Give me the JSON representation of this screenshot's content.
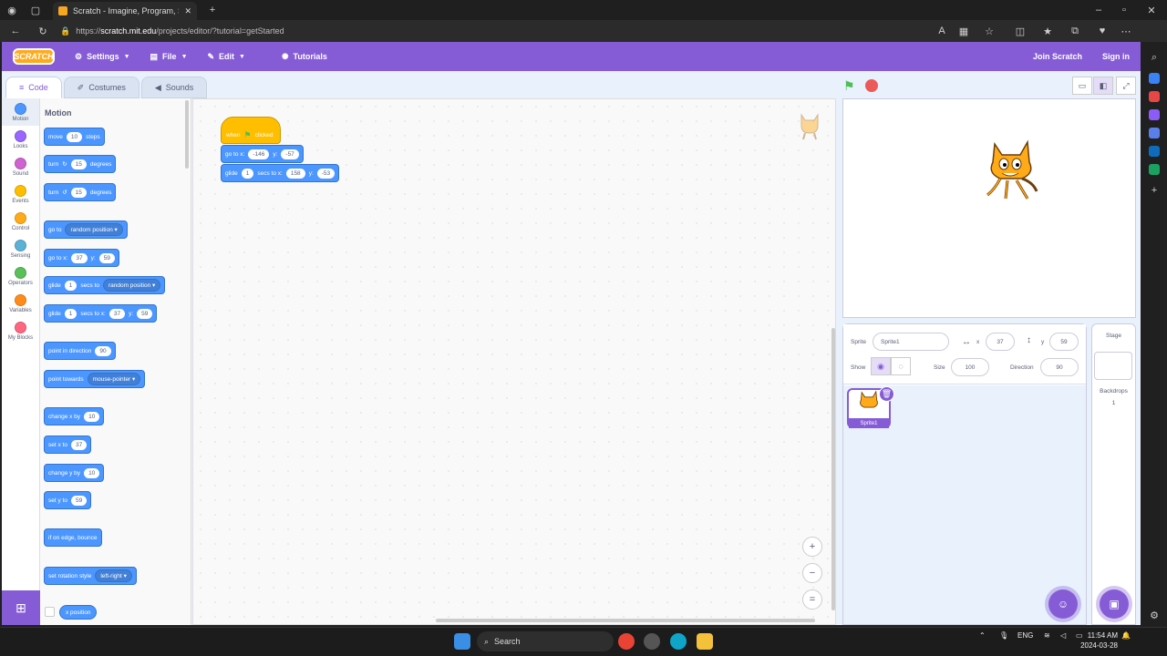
{
  "browser": {
    "tab_title": "Scratch - Imagine, Program, Sha",
    "url_host": "scratch.mit.edu",
    "url_prefix": "https://",
    "url_path": "/projects/editor/?tutorial=getStarted"
  },
  "menubar": {
    "logo": "SCRATCH",
    "settings": "Settings",
    "file": "File",
    "edit": "Edit",
    "tutorials": "Tutorials",
    "join": "Join Scratch",
    "signin": "Sign in"
  },
  "tabs": {
    "code": "Code",
    "costumes": "Costumes",
    "sounds": "Sounds"
  },
  "categories": [
    {
      "label": "Motion",
      "color": "#4c97ff"
    },
    {
      "label": "Looks",
      "color": "#9966ff"
    },
    {
      "label": "Sound",
      "color": "#cf63cf"
    },
    {
      "label": "Events",
      "color": "#ffbf00"
    },
    {
      "label": "Control",
      "color": "#ffab19"
    },
    {
      "label": "Sensing",
      "color": "#5cb1d6"
    },
    {
      "label": "Operators",
      "color": "#59c059"
    },
    {
      "label": "Variables",
      "color": "#ff8c1a"
    },
    {
      "label": "My Blocks",
      "color": "#ff6680"
    }
  ],
  "palette": {
    "title": "Motion",
    "move": {
      "a": "move",
      "n": "10",
      "b": "steps"
    },
    "turn_cw": {
      "a": "turn",
      "n": "15",
      "b": "degrees"
    },
    "turn_ccw": {
      "a": "turn",
      "n": "15",
      "b": "degrees"
    },
    "goto": {
      "a": "go to",
      "dd": "random position"
    },
    "gotoxy": {
      "a": "go to x:",
      "x": "37",
      "b": "y:",
      "y": "59"
    },
    "glide_to": {
      "a": "glide",
      "n": "1",
      "b": "secs to",
      "dd": "random position"
    },
    "glide_xy": {
      "a": "glide",
      "n": "1",
      "b": "secs to x:",
      "x": "37",
      "c": "y:",
      "y": "59"
    },
    "point_dir": {
      "a": "point in direction",
      "n": "90"
    },
    "point_towards": {
      "a": "point towards",
      "dd": "mouse-pointer"
    },
    "change_x": {
      "a": "change x by",
      "n": "10"
    },
    "set_x": {
      "a": "set x to",
      "n": "37"
    },
    "change_y": {
      "a": "change y by",
      "n": "10"
    },
    "set_y": {
      "a": "set y to",
      "n": "59"
    },
    "bounce": {
      "a": "if on edge, bounce"
    },
    "rot_style": {
      "a": "set rotation style",
      "dd": "left-right"
    },
    "xpos": {
      "a": "x position"
    }
  },
  "script": {
    "hat": {
      "a": "when",
      "b": "clicked"
    },
    "gotoxy": {
      "a": "go to x:",
      "x": "-146",
      "b": "y:",
      "y": "-57"
    },
    "glide": {
      "a": "glide",
      "n": "1",
      "b": "secs to x:",
      "x": "158",
      "c": "y:",
      "y": "-53"
    }
  },
  "zoom": {
    "in": "+",
    "out": "−",
    "reset": "="
  },
  "sprite_info": {
    "sprite_label": "Sprite",
    "sprite_name": "Sprite1",
    "x_label": "x",
    "x": "37",
    "y_label": "y",
    "y": "59",
    "show_label": "Show",
    "size_label": "Size",
    "size": "100",
    "direction_label": "Direction",
    "direction": "90"
  },
  "sprites": [
    {
      "name": "Sprite1"
    }
  ],
  "stage_pane": {
    "title": "Stage",
    "backdrops_label": "Backdrops",
    "backdrops_count": "1"
  },
  "taskbar": {
    "search": "Search",
    "lang": "ENG",
    "time": "11:54 AM",
    "date": "2024-03-28"
  },
  "colors": {
    "brand": "#855cd6",
    "motion": "#4c97ff",
    "events": "#ffbf00"
  }
}
